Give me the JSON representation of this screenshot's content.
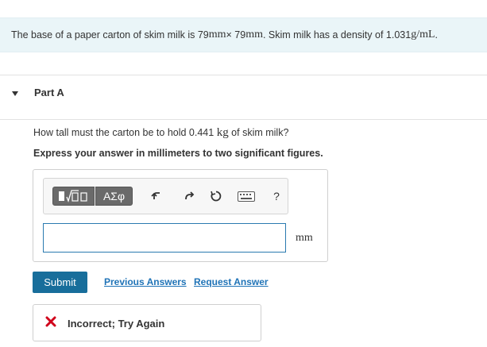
{
  "problem": {
    "text_before": "The base of a paper carton of skim milk is 79 ",
    "unit_mm_1": "mm",
    "times": "× 79 ",
    "unit_mm_2": "mm",
    "text_mid": ". Skim milk has a density of 1.031 ",
    "density_unit": "g/mL",
    "text_end": "."
  },
  "part": {
    "title": "Part A"
  },
  "question": {
    "text_before": "How tall must the carton be to hold 0.441 ",
    "mass_unit": "kg",
    "text_after": " of skim milk?"
  },
  "instruction": "Express your answer in millimeters to two significant figures.",
  "toolbar": {
    "symbols_label": "ΑΣφ",
    "help_label": "?"
  },
  "answer": {
    "value": "",
    "unit": "mm"
  },
  "actions": {
    "submit_label": "Submit",
    "previous_answers_label": "Previous Answers",
    "request_answer_label": "Request Answer"
  },
  "feedback": {
    "text": "Incorrect; Try Again",
    "status_color": "#d0021b"
  },
  "colors": {
    "accent": "#186e9b",
    "link": "#1f73b7",
    "problem_bg": "#eaf5f8"
  }
}
